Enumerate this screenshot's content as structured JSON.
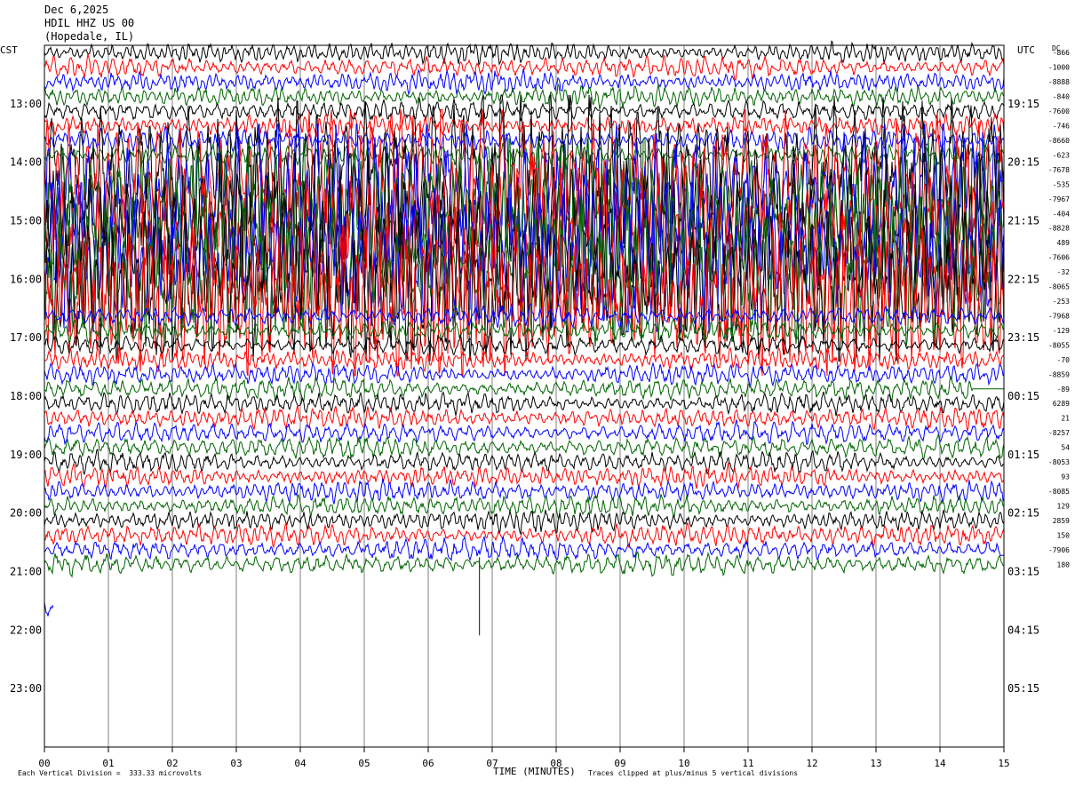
{
  "header": {
    "date": "Dec 6,2025",
    "station": "HDIL HHZ US 00",
    "location": "(Hopedale, IL)"
  },
  "left_axis_label": "CST",
  "right_axis_label": "UTC",
  "right_column_label": "DC",
  "footer": {
    "scale_note": "Each Vertical Division =  333.33 microvolts",
    "clip_note": "Traces clipped at plus/minus 5 vertical divisions",
    "x_title": "TIME (MINUTES)"
  },
  "colors": {
    "trace_cycle": [
      "#000000",
      "#ff0000",
      "#0000ff",
      "#006400"
    ],
    "grid": "#808080",
    "frame": "#000000",
    "background": "#ffffff"
  },
  "chart_data": {
    "type": "line",
    "title": "HDIL HHZ US 00 (Hopedale, IL)",
    "xlabel": "TIME (MINUTES)",
    "x_range": [
      0,
      15
    ],
    "x_ticks": [
      "00",
      "01",
      "02",
      "03",
      "04",
      "05",
      "06",
      "07",
      "08",
      "09",
      "10",
      "11",
      "12",
      "13",
      "14",
      "15"
    ],
    "rows_per_hour": 4,
    "minutes_per_row": 15,
    "start_time_cst": "12:00",
    "y_ticks_left": [
      "13:00",
      "14:00",
      "15:00",
      "16:00",
      "17:00",
      "18:00",
      "19:00",
      "20:00",
      "21:00",
      "22:00",
      "23:00"
    ],
    "y_ticks_right": [
      "19:15",
      "20:15",
      "21:15",
      "22:15",
      "23:15",
      "00:15",
      "01:15",
      "02:15",
      "03:15",
      "04:15",
      "05:15"
    ],
    "row_offsets": [
      "-866",
      "-1000",
      "-8888",
      "-840",
      "-7600",
      "-746",
      "-8660",
      "-623",
      "-7678",
      "-535",
      "-7967",
      "-404",
      "-8828",
      "489",
      "-7606",
      "-32",
      "-8065",
      "-253",
      "-7968",
      "-129",
      "-8055",
      "-70",
      "-8859",
      "-89",
      "6289",
      "21",
      "-8257",
      "54",
      "-8053",
      "93",
      "-8085",
      "129",
      "2859",
      "150",
      "-7906",
      "180"
    ],
    "trace_rows": 36,
    "partial_row_end_minute": 0.15,
    "total_rows": 48,
    "segments": [
      {
        "rows": [
          0,
          7
        ],
        "activity": "moderate"
      },
      {
        "rows": [
          8,
          17
        ],
        "activity": "clipped"
      },
      {
        "rows": [
          18,
          35
        ],
        "activity": "moderate"
      }
    ],
    "events": [
      {
        "row": 35,
        "minute": 6.8,
        "note": "large downward spike"
      },
      {
        "row": 23,
        "minute": 14.5,
        "note": "trace flat to end"
      }
    ],
    "clip_divisions": 5,
    "microvolts_per_division": 333.33
  }
}
